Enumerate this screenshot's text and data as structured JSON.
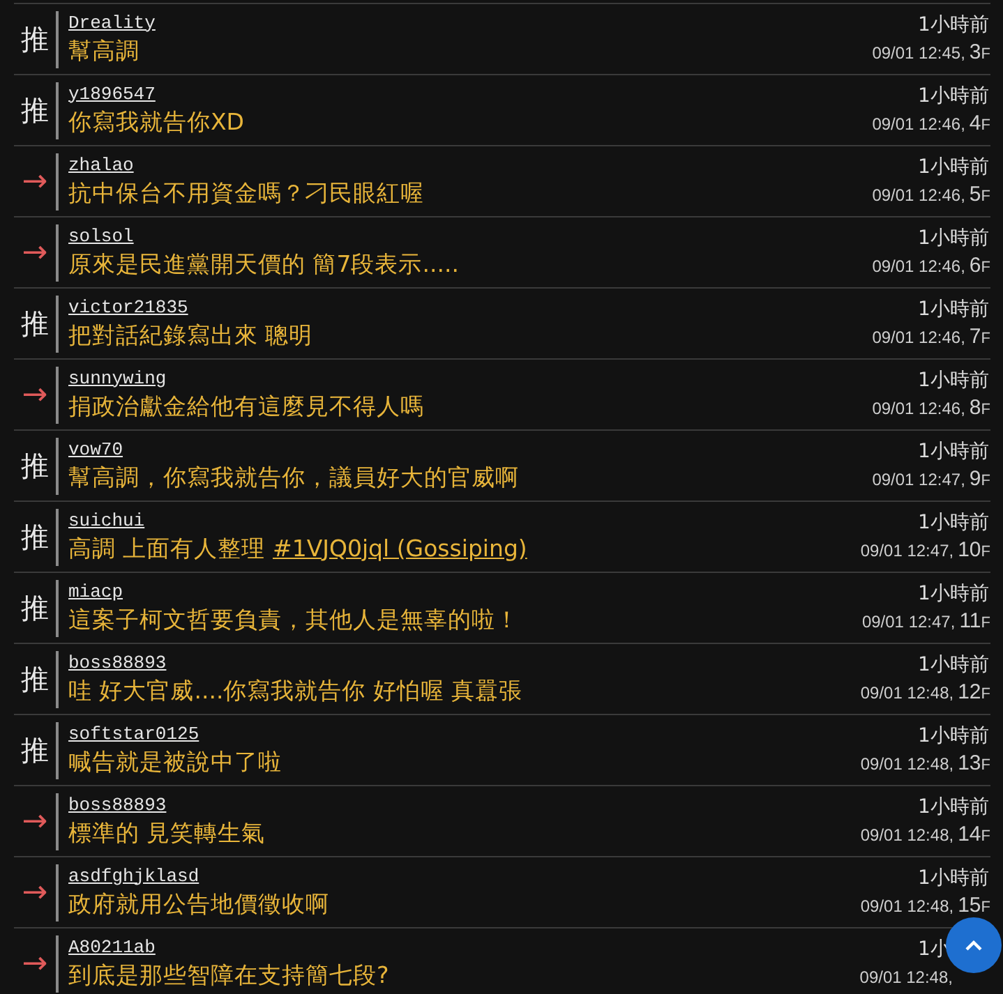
{
  "comments": [
    {
      "kind": "push",
      "tag": "推",
      "user": "Dreality",
      "content": "幫高調",
      "time": "1小時前",
      "date": "09/01 12:45,",
      "floor": "3",
      "floor_unit": "F"
    },
    {
      "kind": "push",
      "tag": "推",
      "user": "y1896547",
      "content": "你寫我就告你XD",
      "time": "1小時前",
      "date": "09/01 12:46,",
      "floor": "4",
      "floor_unit": "F"
    },
    {
      "kind": "arrow",
      "tag": "→",
      "user": "zhalao",
      "content": "抗中保台不用資金嗎？刁民眼紅喔",
      "time": "1小時前",
      "date": "09/01 12:46,",
      "floor": "5",
      "floor_unit": "F"
    },
    {
      "kind": "arrow",
      "tag": "→",
      "user": "solsol",
      "content": "原來是民進黨開天價的 簡7段表示.....",
      "time": "1小時前",
      "date": "09/01 12:46,",
      "floor": "6",
      "floor_unit": "F"
    },
    {
      "kind": "push",
      "tag": "推",
      "user": "victor21835",
      "content": "把對話紀錄寫出來 聰明",
      "time": "1小時前",
      "date": "09/01 12:46,",
      "floor": "7",
      "floor_unit": "F"
    },
    {
      "kind": "arrow",
      "tag": "→",
      "user": "sunnywing",
      "content": "捐政治獻金給他有這麼見不得人嗎",
      "time": "1小時前",
      "date": "09/01 12:46,",
      "floor": "8",
      "floor_unit": "F"
    },
    {
      "kind": "push",
      "tag": "推",
      "user": "vow70",
      "content": "幫高調，你寫我就告你，議員好大的官威啊",
      "time": "1小時前",
      "date": "09/01 12:47,",
      "floor": "9",
      "floor_unit": "F"
    },
    {
      "kind": "push",
      "tag": "推",
      "user": "suichui",
      "content": "高調 上面有人整理 ",
      "link": "#1VJQ0jql (Gossiping)",
      "time": "1小時前",
      "date": "09/01 12:47,",
      "floor": "10",
      "floor_unit": "F"
    },
    {
      "kind": "push",
      "tag": "推",
      "user": "miacp",
      "content": "這案子柯文哲要負責，其他人是無辜的啦！",
      "time": "1小時前",
      "date": "09/01 12:47,",
      "floor": "11",
      "floor_unit": "F"
    },
    {
      "kind": "push",
      "tag": "推",
      "user": "boss88893",
      "content": "哇 好大官威....你寫我就告你 好怕喔 真囂張",
      "time": "1小時前",
      "date": "09/01 12:48,",
      "floor": "12",
      "floor_unit": "F"
    },
    {
      "kind": "push",
      "tag": "推",
      "user": "softstar0125",
      "content": "喊告就是被說中了啦",
      "time": "1小時前",
      "date": "09/01 12:48,",
      "floor": "13",
      "floor_unit": "F"
    },
    {
      "kind": "arrow",
      "tag": "→",
      "user": "boss88893",
      "content": "標準的 見笑轉生氣",
      "time": "1小時前",
      "date": "09/01 12:48,",
      "floor": "14",
      "floor_unit": "F"
    },
    {
      "kind": "arrow",
      "tag": "→",
      "user": "asdfghjklasd",
      "content": "政府就用公告地價徵收啊",
      "time": "1小時前",
      "date": "09/01 12:48,",
      "floor": "15",
      "floor_unit": "F"
    },
    {
      "kind": "arrow",
      "tag": "→",
      "user": "A80211ab",
      "content": "到底是那些智障在支持簡七段?",
      "time": "1小",
      "date": "09/01 12:48,"
    }
  ]
}
